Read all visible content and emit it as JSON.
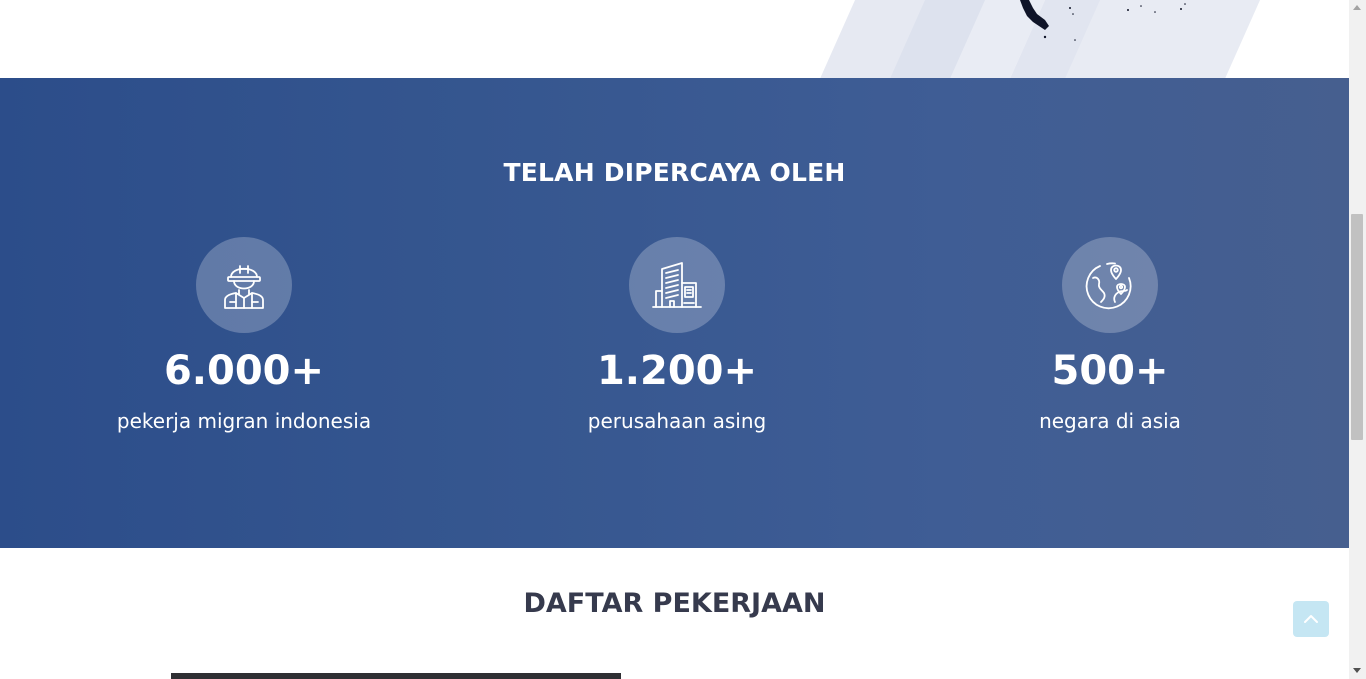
{
  "stats": {
    "title": "TELAH DIPERCAYA OLEH",
    "items": [
      {
        "icon": "worker-icon",
        "value": "6.000+",
        "label": "pekerja migran indonesia"
      },
      {
        "icon": "building-icon",
        "value": "1.200+",
        "label": "perusahaan asing"
      },
      {
        "icon": "globe-location-icon",
        "value": "500+",
        "label": "negara di asia"
      }
    ]
  },
  "jobs": {
    "title": "DAFTAR PEKERJAAN"
  },
  "colors": {
    "band": "#35568f",
    "heading": "#363a4d",
    "to_top_bg": "#c5e6f3"
  },
  "back_to_top": {
    "icon": "chevron-up-icon"
  }
}
